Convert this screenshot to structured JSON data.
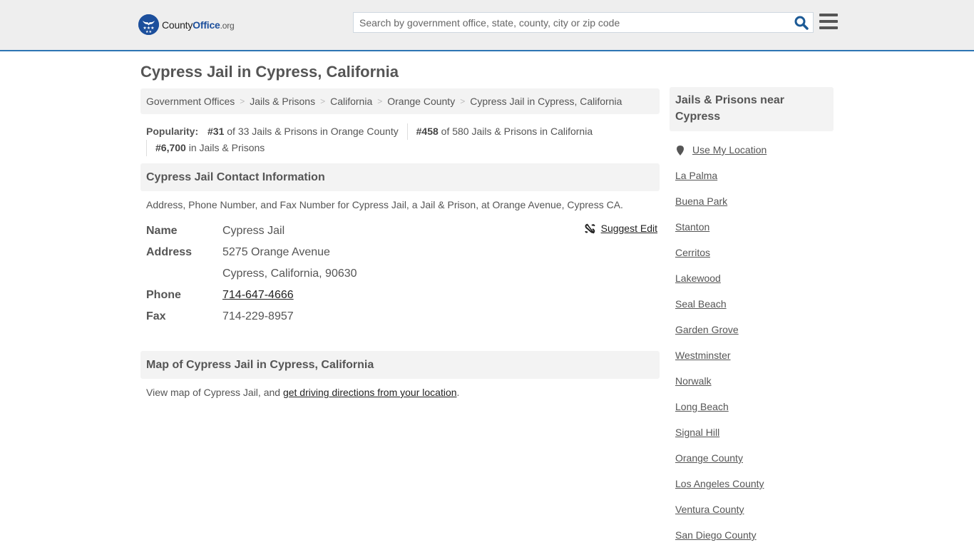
{
  "header": {
    "logo_text_county": "County",
    "logo_text_office": "Office",
    "logo_text_org": ".org",
    "search_placeholder": "Search by government office, state, county, city or zip code",
    "search_icon": "search-icon",
    "menu_icon": "hamburger-menu-icon",
    "accent_color": "#2d75b3"
  },
  "page": {
    "title": "Cypress Jail in Cypress, California"
  },
  "breadcrumb": [
    "Government Offices",
    "Jails & Prisons",
    "California",
    "Orange County",
    "Cypress Jail in Cypress, California"
  ],
  "popularity": {
    "label": "Popularity:",
    "items": [
      {
        "rank": "#31",
        "text": "of 33 Jails & Prisons in Orange County"
      },
      {
        "rank": "#458",
        "text": "of 580 Jails & Prisons in California"
      },
      {
        "rank": "#6,700",
        "text": "in Jails & Prisons"
      }
    ]
  },
  "contact": {
    "heading": "Cypress Jail Contact Information",
    "description": "Address, Phone Number, and Fax Number for Cypress Jail, a Jail & Prison, at Orange Avenue, Cypress CA.",
    "suggest_edit": "Suggest Edit",
    "fields": {
      "name_label": "Name",
      "name_value": "Cypress Jail",
      "address_label": "Address",
      "address_line1": "5275 Orange Avenue",
      "address_line2": "Cypress, California, 90630",
      "phone_label": "Phone",
      "phone_value": "714-647-4666",
      "fax_label": "Fax",
      "fax_value": "714-229-8957"
    }
  },
  "map": {
    "heading": "Map of Cypress Jail in Cypress, California",
    "desc_prefix": "View map of Cypress Jail, and ",
    "desc_link": "get driving directions from your location",
    "desc_suffix": "."
  },
  "sidebar": {
    "heading": "Jails & Prisons near Cypress",
    "use_location": "Use My Location",
    "links": [
      "La Palma",
      "Buena Park",
      "Stanton",
      "Cerritos",
      "Lakewood",
      "Seal Beach",
      "Garden Grove",
      "Westminster",
      "Norwalk",
      "Long Beach",
      "Signal Hill",
      "Orange County",
      "Los Angeles County",
      "Ventura County",
      "San Diego County"
    ]
  }
}
